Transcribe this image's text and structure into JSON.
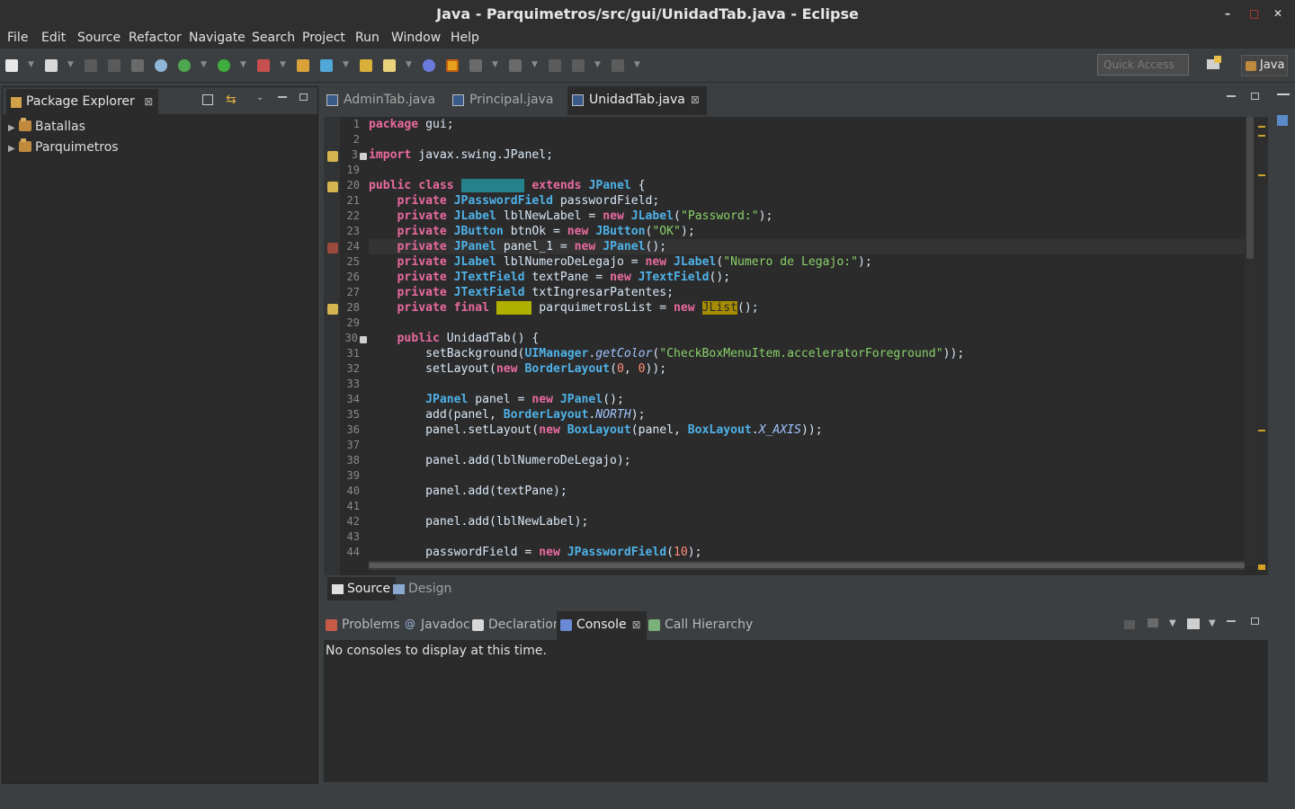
{
  "window": {
    "title": "Java - Parquimetros/src/gui/UnidadTab.java - Eclipse",
    "min_glyph": "–",
    "max_glyph": "□",
    "close_glyph": "✕"
  },
  "menu": [
    "File",
    "Edit",
    "Source",
    "Refactor",
    "Navigate",
    "Search",
    "Project",
    "Run",
    "Window",
    "Help"
  ],
  "toolbar": {
    "quick_access_placeholder": "Quick Access",
    "perspective_label": "Java"
  },
  "package_explorer": {
    "title": "Package Explorer",
    "projects": [
      "Batallas",
      "Parquimetros"
    ]
  },
  "editor": {
    "tabs": [
      {
        "label": "AdminTab.java",
        "active": false
      },
      {
        "label": "Principal.java",
        "active": false
      },
      {
        "label": "UnidadTab.java",
        "active": true
      }
    ],
    "line_numbers": [
      "1",
      "2",
      "3",
      "19",
      "20",
      "21",
      "22",
      "23",
      "24",
      "25",
      "26",
      "27",
      "28",
      "29",
      "30",
      "31",
      "32",
      "33",
      "34",
      "35",
      "36",
      "37",
      "38",
      "39",
      "40",
      "41",
      "42",
      "43",
      "44"
    ],
    "lines": [
      "package gui;",
      "",
      "import javax.swing.JPanel;",
      "",
      "public class UnidadTab extends JPanel {",
      "    private JPasswordField passwordField;",
      "    private JLabel lblNewLabel = new JLabel(\"Password:\");",
      "    private JButton btnOk = new JButton(\"OK\");",
      "    private JPanel panel_1 = new JPanel();",
      "    private JLabel lblNumeroDeLegajo = new JLabel(\"Numero de Legajo:\");",
      "    private JTextField textPane = new JTextField();",
      "    private JTextField txtIngresarPatentes;",
      "    private final JList parquimetrosList = new JList();",
      "",
      "    public UnidadTab() {",
      "        setBackground(UIManager.getColor(\"CheckBoxMenuItem.acceleratorForeground\"));",
      "        setLayout(new BorderLayout(0, 0));",
      "",
      "        JPanel panel = new JPanel();",
      "        add(panel, BorderLayout.NORTH);",
      "        panel.setLayout(new BoxLayout(panel, BoxLayout.X_AXIS));",
      "",
      "        panel.add(lblNumeroDeLegajo);",
      "",
      "        panel.add(textPane);",
      "",
      "        panel.add(lblNewLabel);",
      "",
      "        passwordField = new JPasswordField(10);"
    ],
    "bottom_tabs": [
      "Source",
      "Design"
    ]
  },
  "bottom_panel": {
    "tabs": [
      {
        "label": "Problems",
        "active": false
      },
      {
        "label": "Javadoc",
        "active": false
      },
      {
        "label": "Declaration",
        "active": false
      },
      {
        "label": "Console",
        "active": true
      },
      {
        "label": "Call Hierarchy",
        "active": false
      }
    ],
    "console_message": "No consoles to display at this time."
  },
  "colors": {
    "keyword": "#e96a9f",
    "type": "#4fb2e8",
    "string": "#8ad26a",
    "background": "#2b2b2b",
    "chrome": "#3c3f41"
  }
}
